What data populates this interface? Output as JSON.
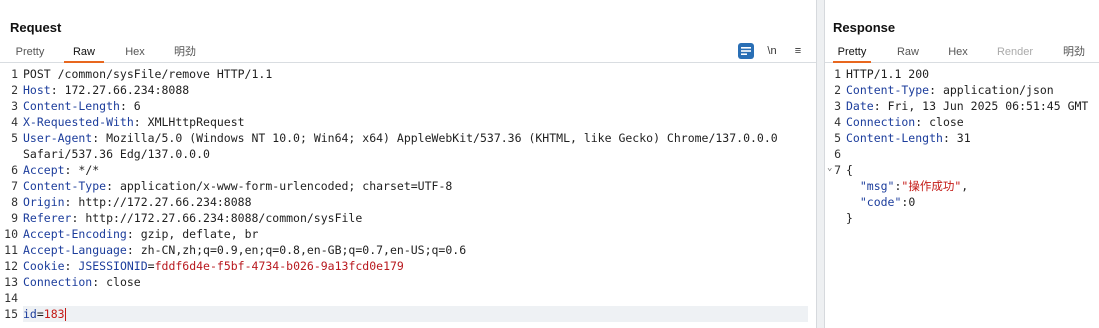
{
  "request": {
    "title": "Request",
    "tabs": [
      "Pretty",
      "Raw",
      "Hex",
      "明劲"
    ],
    "active_tab": "Raw",
    "icons": [
      "wrap-icon",
      "newline-icon",
      "menu-icon"
    ],
    "newline_label": "\\n",
    "menu_label": "≡",
    "request_line": "POST /common/sysFile/remove HTTP/1.1",
    "headers": [
      {
        "name": "Host",
        "value": "172.27.66.234:8088"
      },
      {
        "name": "Content-Length",
        "value": "6"
      },
      {
        "name": "X-Requested-With",
        "value": "XMLHttpRequest"
      },
      {
        "name": "User-Agent",
        "value": "Mozilla/5.0 (Windows NT 10.0; Win64; x64) AppleWebKit/537.36 (KHTML, like Gecko) Chrome/137.0.0.0"
      },
      {
        "name": "",
        "value": "Safari/537.36 Edg/137.0.0.0"
      },
      {
        "name": "Accept",
        "value": "*/*"
      },
      {
        "name": "Content-Type",
        "value": "application/x-www-form-urlencoded; charset=UTF-8"
      },
      {
        "name": "Origin",
        "value": "http://172.27.66.234:8088"
      },
      {
        "name": "Referer",
        "value": "http://172.27.66.234:8088/common/sysFile"
      },
      {
        "name": "Accept-Encoding",
        "value": "gzip, deflate, br"
      },
      {
        "name": "Accept-Language",
        "value": "zh-CN,zh;q=0.9,en;q=0.8,en-GB;q=0.7,en-US;q=0.6"
      }
    ],
    "cookie": {
      "name": "Cookie",
      "key": "JSESSIONID",
      "value": "fddf6d4e-f5bf-4734-b026-9a13fcd0e179"
    },
    "connection": {
      "name": "Connection",
      "value": "close"
    },
    "body": {
      "param": "id",
      "value": "183"
    },
    "line_numbers": [
      "1",
      "2",
      "3",
      "4",
      "5",
      "",
      "6",
      "7",
      "8",
      "9",
      "10",
      "11",
      "12",
      "13",
      "14",
      "15"
    ]
  },
  "response": {
    "title": "Response",
    "tabs": [
      "Pretty",
      "Raw",
      "Hex",
      "Render",
      "明劲"
    ],
    "active_tab": "Pretty",
    "status_line": "HTTP/1.1 200",
    "headers": [
      {
        "name": "Content-Type",
        "value": "application/json"
      },
      {
        "name": "Date",
        "value": "Fri, 13 Jun 2025 06:51:45 GMT"
      },
      {
        "name": "Connection",
        "value": "close"
      },
      {
        "name": "Content-Length",
        "value": "31"
      }
    ],
    "json": {
      "open": "{",
      "msg_key": "\"msg\"",
      "msg_val": "\"操作成功\"",
      "code_key": "\"code\"",
      "code_val": "0",
      "close": "}"
    },
    "line_numbers": [
      "1",
      "2",
      "3",
      "4",
      "5",
      "6",
      "7",
      "",
      "",
      "",
      ""
    ]
  }
}
